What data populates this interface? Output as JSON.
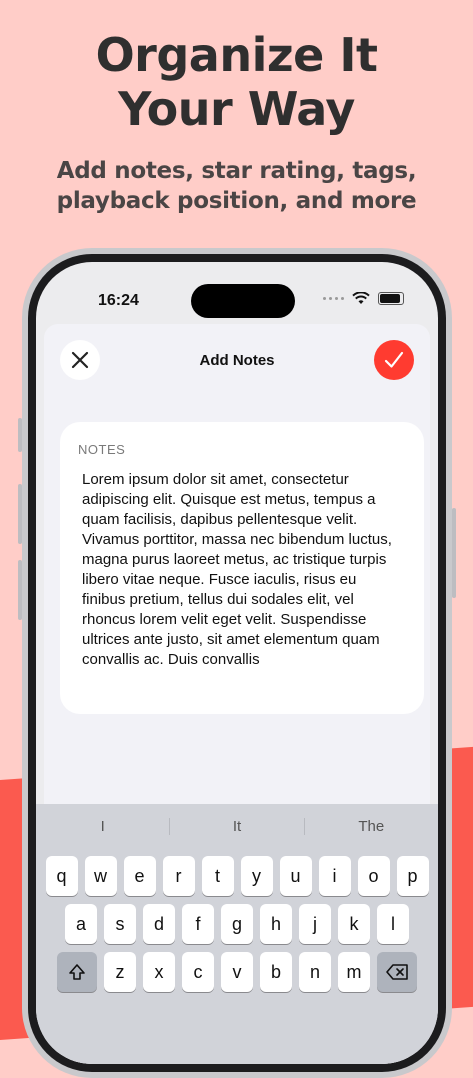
{
  "hero": {
    "headline_line1": "Organize It",
    "headline_line2": "Your Way",
    "subhead_line1": "Add notes, star rating, tags,",
    "subhead_line2": "playback position, and more"
  },
  "status_bar": {
    "time": "16:24"
  },
  "sheet": {
    "title": "Add Notes",
    "close_icon": "close-icon",
    "done_icon": "checkmark-icon"
  },
  "notes": {
    "label": "NOTES",
    "text": "Lorem ipsum dolor sit amet, consectetur adipiscing elit. Quisque est metus, tempus a quam facilisis, dapibus pellentesque velit. Vivamus porttitor, massa nec bibendum luctus, magna purus laoreet metus, ac tristique turpis libero vitae neque. Fusce iaculis, risus eu finibus pretium, tellus dui sodales elit, vel rhoncus lorem velit eget velit. Suspendisse ultrices ante justo, sit amet elementum quam convallis ac. Duis convallis"
  },
  "keyboard": {
    "suggestions": [
      "I",
      "It",
      "The"
    ],
    "row1": [
      "q",
      "w",
      "e",
      "r",
      "t",
      "y",
      "u",
      "i",
      "o",
      "p"
    ],
    "row2": [
      "a",
      "s",
      "d",
      "f",
      "g",
      "h",
      "j",
      "k",
      "l"
    ],
    "row3": [
      "z",
      "x",
      "c",
      "v",
      "b",
      "n",
      "m"
    ]
  },
  "colors": {
    "accent": "#ff3b30",
    "background": "#ffcdc8",
    "bottom_band": "#fb5a4f"
  }
}
